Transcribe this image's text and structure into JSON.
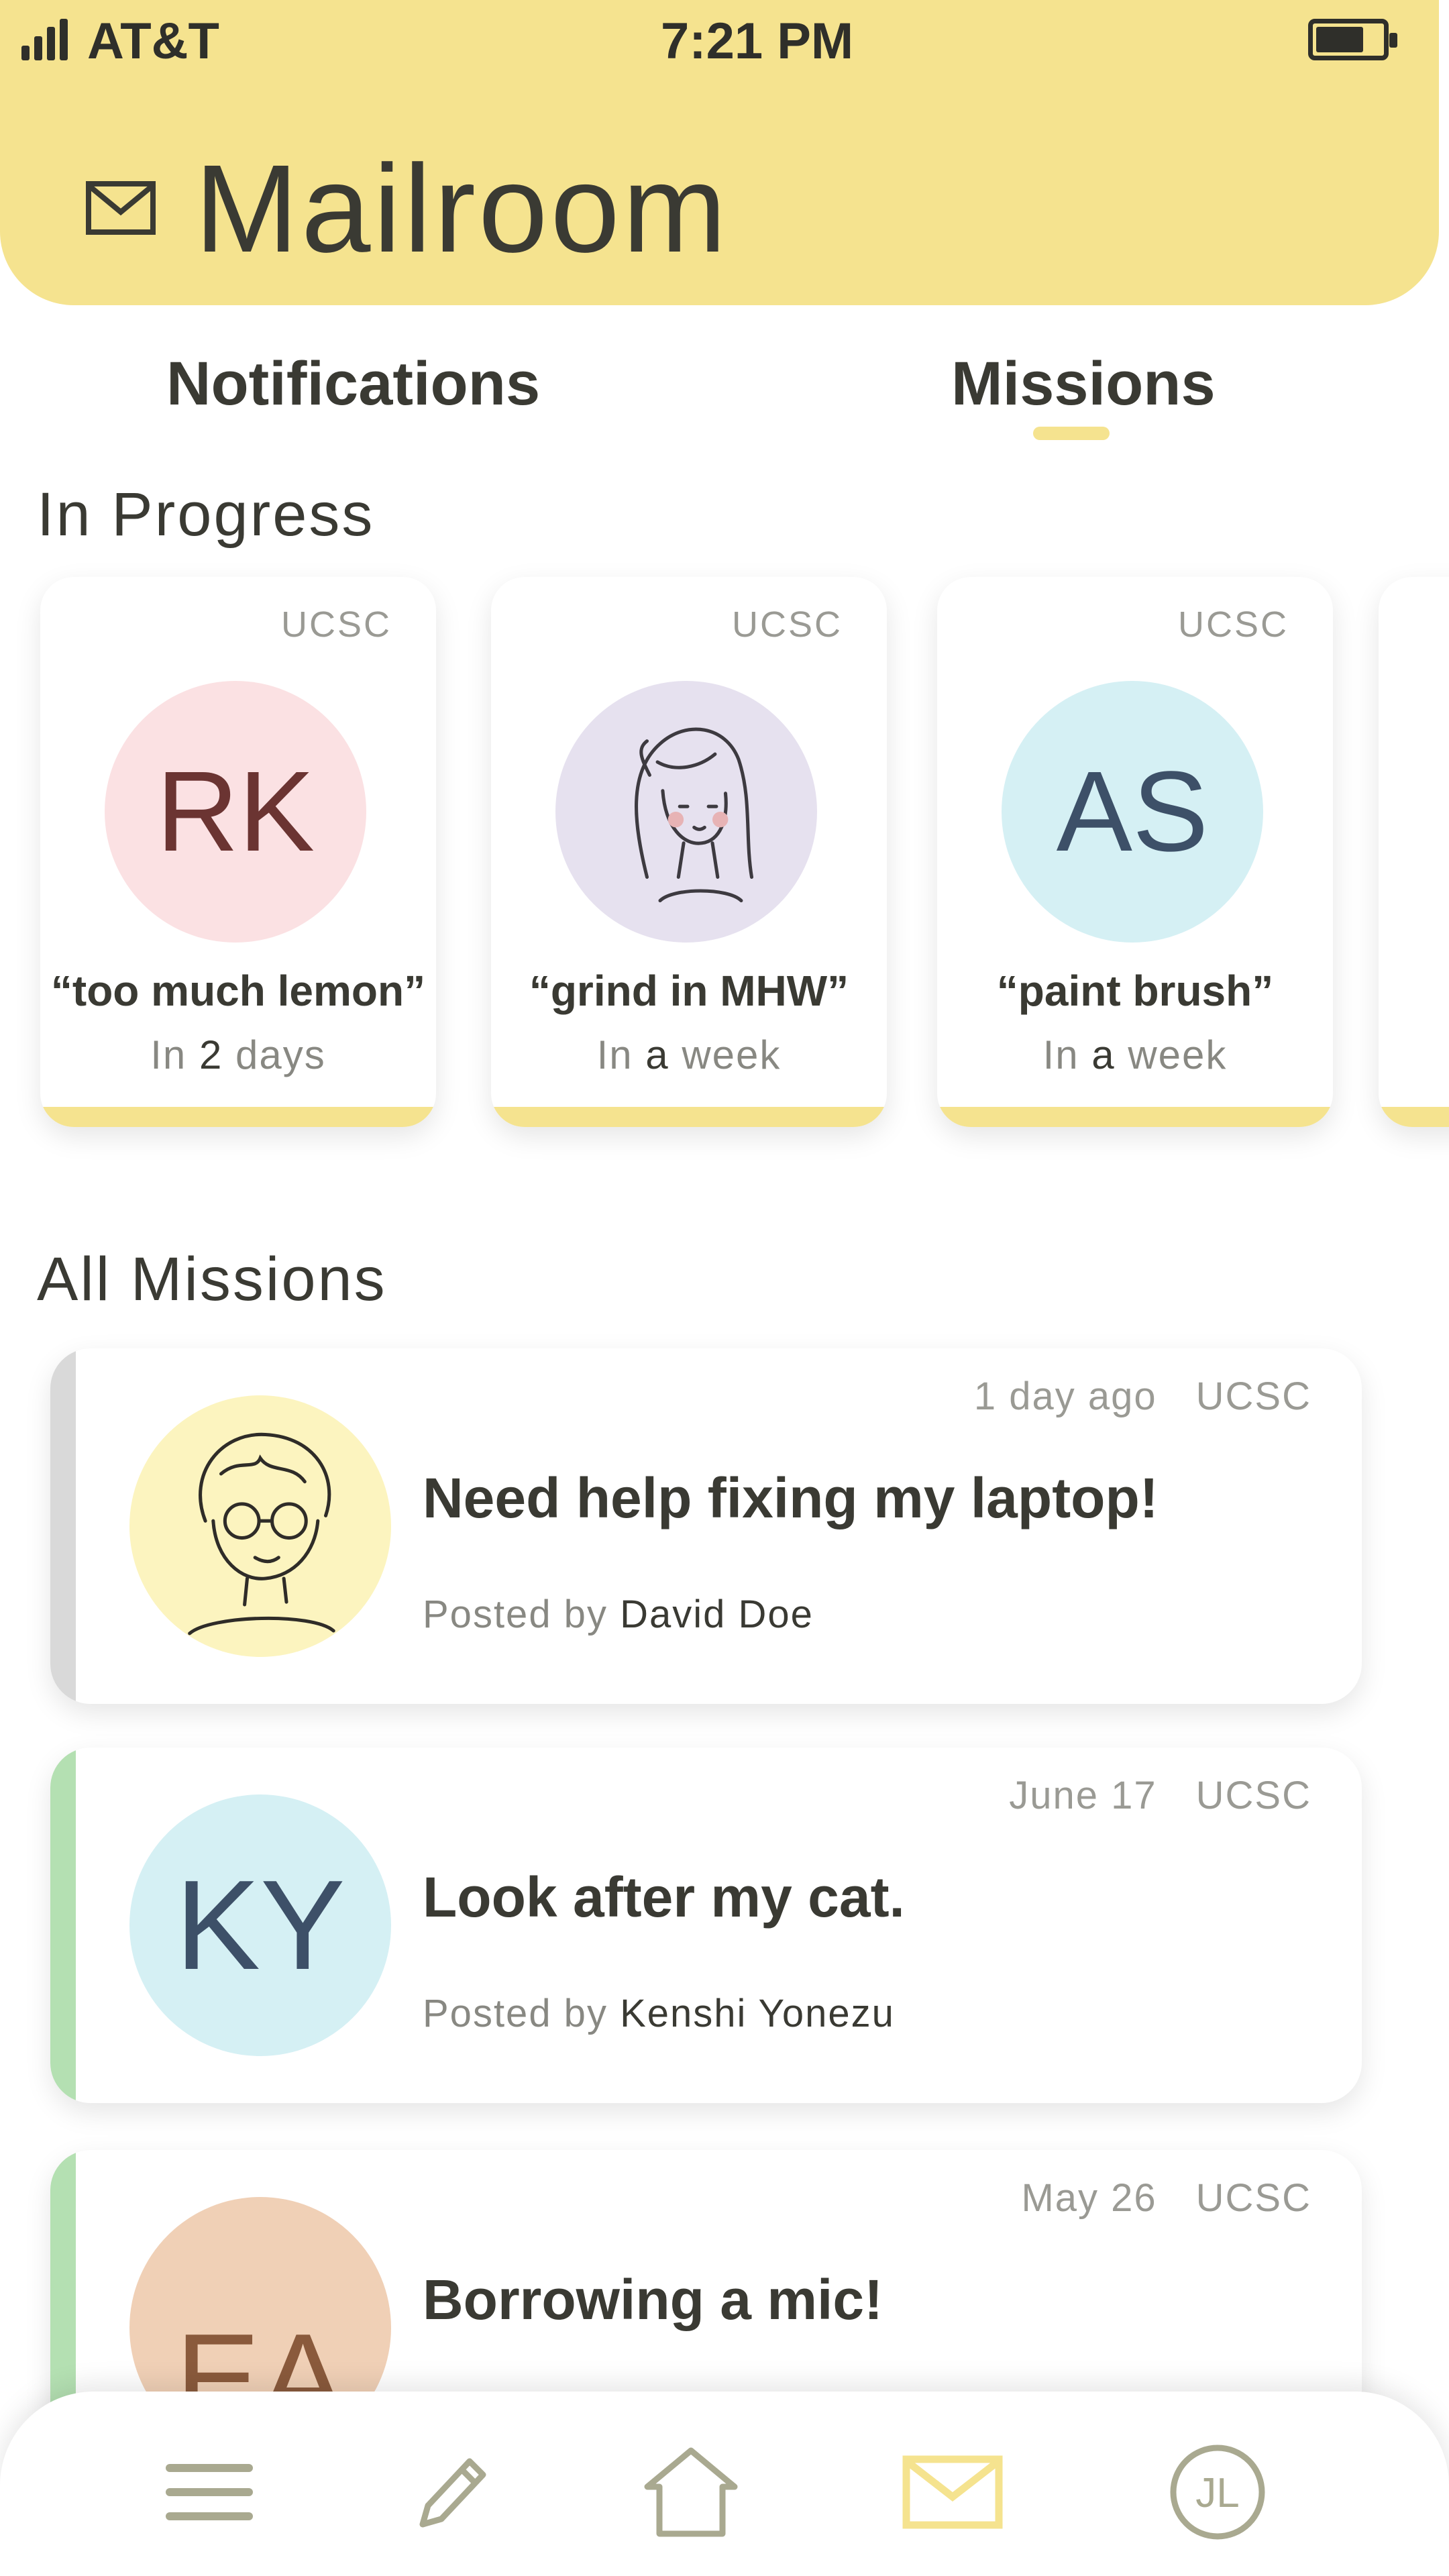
{
  "status_bar": {
    "carrier": "AT&T",
    "time": "7:21 PM"
  },
  "header": {
    "title": "Mailroom",
    "icon": "envelope-icon"
  },
  "tabs": [
    {
      "label": "Notifications",
      "active": false
    },
    {
      "label": "Missions",
      "active": true
    }
  ],
  "in_progress": {
    "title": "In Progress",
    "cards": [
      {
        "tag": "UCSC",
        "initials": "RK",
        "avatar_bg": "#fbe1e3",
        "text_color": "#6b3432",
        "quote": "“too much lemon”",
        "due_prefix": "In",
        "due_value": "2",
        "due_unit": "days"
      },
      {
        "tag": "UCSC",
        "initials": "",
        "avatar_image": "girl-drawing",
        "avatar_bg": "#e6e1ef",
        "quote": "“grind in MHW”",
        "due_prefix": "In",
        "due_value": "a",
        "due_unit": "week"
      },
      {
        "tag": "UCSC",
        "initials": "AS",
        "avatar_bg": "#d5f0f4",
        "text_color": "#3d5068",
        "quote": "“paint brush”",
        "due_prefix": "In",
        "due_value": "a",
        "due_unit": "week"
      }
    ]
  },
  "all_missions": {
    "title": "All Missions",
    "items": [
      {
        "date": "1 day ago",
        "tag": "UCSC",
        "title": "Need help fixing my laptop!",
        "posted_label": "Posted by",
        "poster": "David Doe",
        "accent": "#d9d9d9",
        "avatar_image": "boy-drawing",
        "avatar_bg": "#fcf4bf"
      },
      {
        "date": "June 17",
        "tag": "UCSC",
        "title": "Look after my cat.",
        "posted_label": "Posted by",
        "poster": "Kenshi Yonezu",
        "accent": "#b4e0b2",
        "initials": "KY",
        "avatar_bg": "#d5f0f4",
        "text_color": "#3d5068"
      },
      {
        "date": "May 26",
        "tag": "UCSC",
        "title": "Borrowing a mic!",
        "posted_label": "",
        "poster": "",
        "accent": "#b4e0b2",
        "initials": "EA",
        "avatar_bg": "#f0d0b6",
        "text_color": "#8a5a3c"
      }
    ]
  },
  "bottom_nav": [
    {
      "name": "menu-icon",
      "active": false
    },
    {
      "name": "pencil-icon",
      "active": false
    },
    {
      "name": "home-icon",
      "active": false
    },
    {
      "name": "mail-icon",
      "active": true
    },
    {
      "name": "profile-avatar",
      "initials": "JL",
      "active": false
    }
  ],
  "colors": {
    "accent_yellow": "#f5e38f",
    "text_dark": "#3a3a33",
    "text_muted": "#888882",
    "icon_muted": "#a9a990"
  }
}
